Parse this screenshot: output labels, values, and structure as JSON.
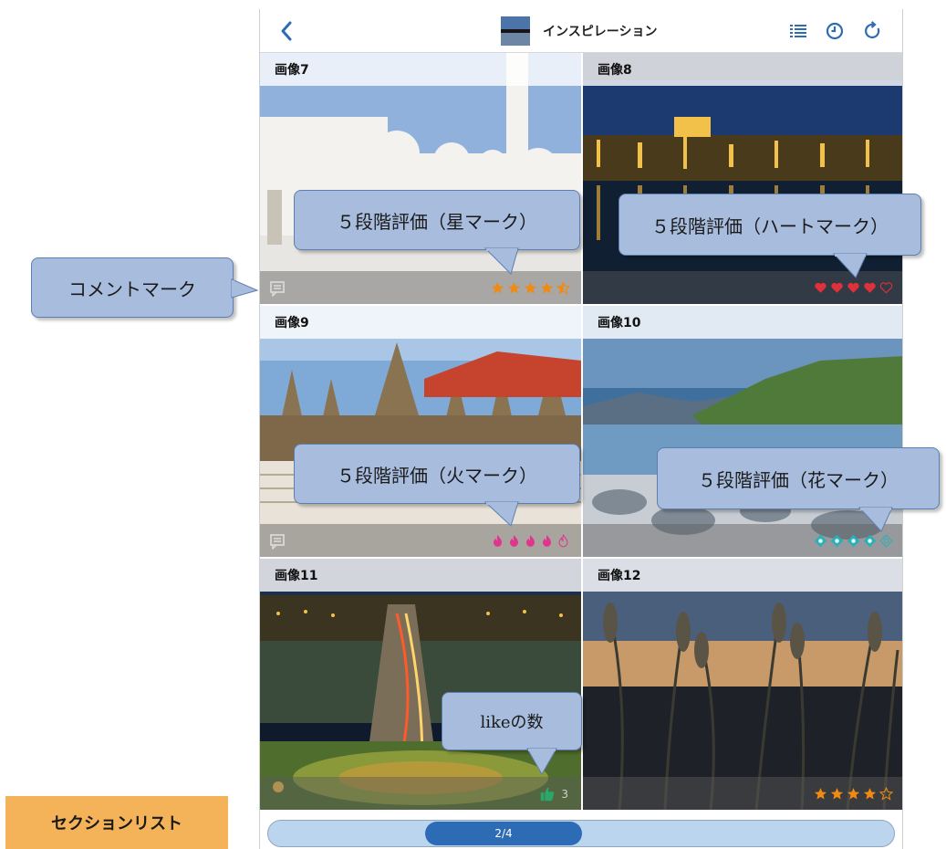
{
  "header": {
    "title": "インスピレーション",
    "back_icon": "chevron-left-icon",
    "list_icon": "list-icon",
    "history_icon": "clock-icon",
    "refresh_icon": "refresh-icon",
    "accent": "#2d6bb5"
  },
  "cells": [
    {
      "title": "画像7",
      "rating_type": "star",
      "rating": 4.5,
      "rating_color": "#f08a10",
      "has_comment": true
    },
    {
      "title": "画像8",
      "rating_type": "heart",
      "rating": 4,
      "rating_color": "#e0303a",
      "has_comment": false
    },
    {
      "title": "画像9",
      "rating_type": "fire",
      "rating": 4,
      "rating_color": "#e0358e",
      "has_comment": true
    },
    {
      "title": "画像10",
      "rating_type": "flower",
      "rating": 4,
      "rating_color": "#2ab0b8",
      "has_comment": false
    },
    {
      "title": "画像11",
      "like_count": "3",
      "like_color": "#2aa86a"
    },
    {
      "title": "画像12",
      "rating_type": "star",
      "rating": 4,
      "rating_color": "#f08a10",
      "has_comment": false
    }
  ],
  "pager": {
    "label": "2/4",
    "current": 2,
    "total": 4
  },
  "callouts": {
    "comment": "コメントマーク",
    "star": "５段階評価（星マーク）",
    "heart": "５段階評価（ハートマーク）",
    "fire": "５段階評価（火マーク）",
    "flower": "５段階評価（花マーク）",
    "like": "likeの数"
  },
  "section_label": "セクションリスト"
}
